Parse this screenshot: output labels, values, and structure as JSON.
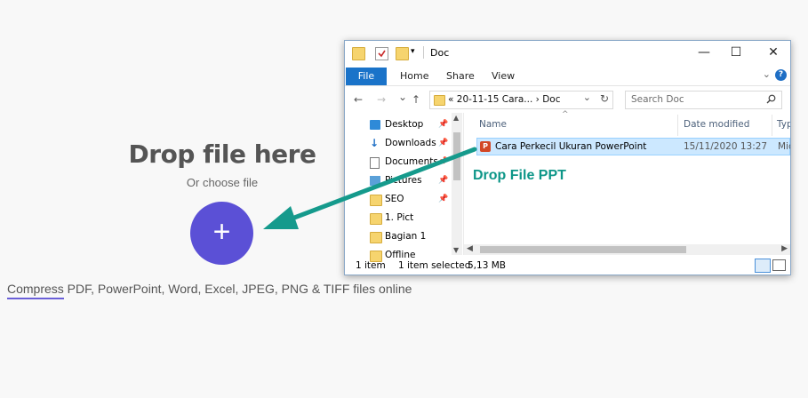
{
  "page": {
    "drop_title": "Drop file here",
    "choose_label": "Or choose file",
    "add_symbol": "+",
    "tagline_link": "Compress",
    "tagline_rest": " PDF, PowerPoint, Word, Excel, JPEG, PNG & TIFF files online",
    "accent_color": "#5b50d6"
  },
  "explorer": {
    "title": "Doc",
    "controls": {
      "minimize": "—",
      "maximize": "☐",
      "close": "✕"
    },
    "ribbon": {
      "file": "File",
      "tabs": [
        "Home",
        "Share",
        "View"
      ],
      "help": "?"
    },
    "address": {
      "back": "←",
      "forward": "→",
      "recent": "⌄",
      "up": "↑",
      "prefix": "«",
      "path": "20-11-15 Cara...",
      "sep": "›",
      "current": "Doc",
      "refresh": "↻"
    },
    "search": {
      "placeholder": "Search Doc"
    },
    "nav_items": [
      {
        "label": "Desktop",
        "icon": "desktop-icon",
        "pinned": true
      },
      {
        "label": "Downloads",
        "icon": "downloads-icon",
        "pinned": true
      },
      {
        "label": "Documents",
        "icon": "documents-icon",
        "pinned": true
      },
      {
        "label": "Pictures",
        "icon": "pictures-icon",
        "pinned": true
      },
      {
        "label": "SEO",
        "icon": "folder-icon",
        "pinned": true
      },
      {
        "label": "1. Pict",
        "icon": "folder-icon",
        "pinned": false
      },
      {
        "label": "Bagian 1",
        "icon": "folder-icon",
        "pinned": false
      },
      {
        "label": "Offline",
        "icon": "folder-icon",
        "pinned": false
      }
    ],
    "columns": [
      "Name",
      "Date modified",
      "Typ"
    ],
    "files": [
      {
        "name": "Cara Perkecil Ukuran PowerPoint",
        "date": "15/11/2020 13:27",
        "type": "Mic",
        "icon": "powerpoint-icon"
      }
    ],
    "status": {
      "count": "1 item",
      "selected": "1 item selected",
      "size": "5,13 MB"
    }
  },
  "annotation": {
    "callout": "Drop File PPT",
    "arrow_color": "#159a8c"
  }
}
